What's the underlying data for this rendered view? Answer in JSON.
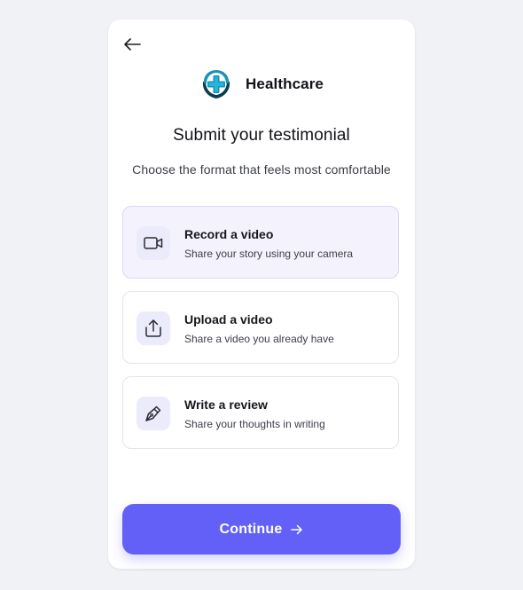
{
  "header": {
    "back_icon": "arrow-left-icon"
  },
  "brand": {
    "name": "Healthcare",
    "logo_icon": "healthcare-cross-hands-logo",
    "colors": {
      "teal": "#1693b8",
      "navy": "#0f3b52"
    }
  },
  "title": "Submit your testimonial",
  "subtitle": "Choose the format that feels most comfortable",
  "options": [
    {
      "title": "Record a video",
      "description": "Share your story using your camera",
      "icon": "video-camera-icon",
      "selected": true
    },
    {
      "title": "Upload a video",
      "description": "Share a video you already have",
      "icon": "upload-icon",
      "selected": false
    },
    {
      "title": "Write a review",
      "description": "Share your thoughts in writing",
      "icon": "pen-icon",
      "selected": false
    }
  ],
  "continue_button": {
    "label": "Continue",
    "icon": "arrow-right-icon"
  },
  "colors": {
    "accent": "#6360f8",
    "background": "#f1f2f6",
    "selected_bg": "#f4f3fd",
    "icon_bg": "#ecebfb"
  }
}
